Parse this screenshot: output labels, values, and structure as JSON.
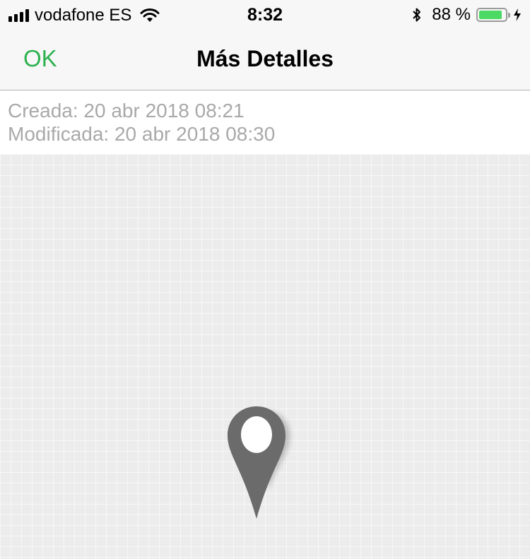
{
  "status_bar": {
    "carrier": "vodafone ES",
    "time": "8:32",
    "battery_text": "88 %",
    "battery_level": 0.88,
    "battery_color": "#4cd964"
  },
  "nav": {
    "ok_label": "OK",
    "title": "Más Detalles",
    "accent_color": "#2db14f"
  },
  "details": {
    "created": "Creada: 20 abr 2018 08:21",
    "modified": "Modificada: 20 abr 2018 08:30"
  },
  "map": {
    "marker_icon": "map-pin-icon"
  }
}
